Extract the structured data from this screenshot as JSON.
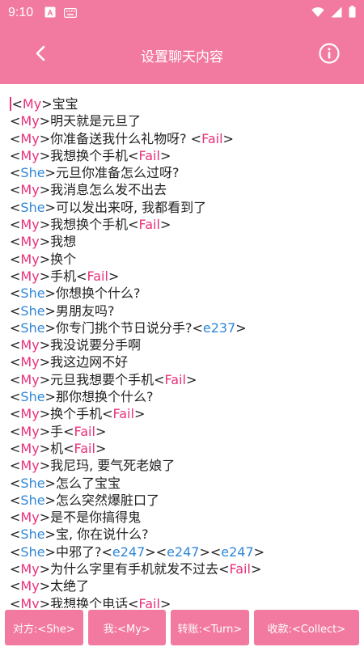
{
  "status_bar": {
    "time": "9:10",
    "icons": [
      "a-box-icon",
      "keyboard-icon",
      "wifi-icon",
      "cell-signal-icon",
      "battery-icon"
    ]
  },
  "app_bar": {
    "title": "设置聊天内容",
    "back_icon": "chevron-left-icon",
    "info_icon": "info-icon"
  },
  "colors": {
    "accent": "#f27aa0",
    "my_tag": "#e8317b",
    "she_tag": "#2f86d6",
    "fail_tag": "#e8317b",
    "emoji_tag": "#2f86d6"
  },
  "editor": {
    "lines": [
      [
        {
          "t": "<",
          "c": "p"
        },
        {
          "t": "My",
          "c": "my"
        },
        {
          "t": ">宝宝",
          "c": "p"
        }
      ],
      [
        {
          "t": "<",
          "c": "p"
        },
        {
          "t": "My",
          "c": "my"
        },
        {
          "t": ">明天就是元旦了",
          "c": "p"
        }
      ],
      [
        {
          "t": "<",
          "c": "p"
        },
        {
          "t": "My",
          "c": "my"
        },
        {
          "t": ">你准备送我什么礼物呀? <",
          "c": "p"
        },
        {
          "t": "Fail",
          "c": "fail"
        },
        {
          "t": ">",
          "c": "p"
        }
      ],
      [
        {
          "t": "<",
          "c": "p"
        },
        {
          "t": "My",
          "c": "my"
        },
        {
          "t": ">我想换个手机<",
          "c": "p"
        },
        {
          "t": "Fail",
          "c": "fail"
        },
        {
          "t": ">",
          "c": "p"
        }
      ],
      [
        {
          "t": "<",
          "c": "p"
        },
        {
          "t": "She",
          "c": "she"
        },
        {
          "t": ">元旦你准备怎么过呀?",
          "c": "p"
        }
      ],
      [
        {
          "t": "<",
          "c": "p"
        },
        {
          "t": "My",
          "c": "my"
        },
        {
          "t": ">我消息怎么发不出去",
          "c": "p"
        }
      ],
      [
        {
          "t": "<",
          "c": "p"
        },
        {
          "t": "She",
          "c": "she"
        },
        {
          "t": ">可以发出来呀, 我都看到了",
          "c": "p"
        }
      ],
      [
        {
          "t": "<",
          "c": "p"
        },
        {
          "t": "My",
          "c": "my"
        },
        {
          "t": ">我想换个手机<",
          "c": "p"
        },
        {
          "t": "Fail",
          "c": "fail"
        },
        {
          "t": ">",
          "c": "p"
        }
      ],
      [
        {
          "t": "<",
          "c": "p"
        },
        {
          "t": "My",
          "c": "my"
        },
        {
          "t": ">我想",
          "c": "p"
        }
      ],
      [
        {
          "t": "<",
          "c": "p"
        },
        {
          "t": "My",
          "c": "my"
        },
        {
          "t": ">换个",
          "c": "p"
        }
      ],
      [
        {
          "t": "<",
          "c": "p"
        },
        {
          "t": "My",
          "c": "my"
        },
        {
          "t": ">手机<",
          "c": "p"
        },
        {
          "t": "Fail",
          "c": "fail"
        },
        {
          "t": ">",
          "c": "p"
        }
      ],
      [
        {
          "t": "<",
          "c": "p"
        },
        {
          "t": "She",
          "c": "she"
        },
        {
          "t": ">你想换个什么?",
          "c": "p"
        }
      ],
      [
        {
          "t": "<",
          "c": "p"
        },
        {
          "t": "She",
          "c": "she"
        },
        {
          "t": ">男朋友吗?",
          "c": "p"
        }
      ],
      [
        {
          "t": "<",
          "c": "p"
        },
        {
          "t": "She",
          "c": "she"
        },
        {
          "t": ">你专门挑个节日说分手?<",
          "c": "p"
        },
        {
          "t": "e237",
          "c": "e"
        },
        {
          "t": ">",
          "c": "p"
        }
      ],
      [
        {
          "t": "<",
          "c": "p"
        },
        {
          "t": "My",
          "c": "my"
        },
        {
          "t": ">我没说要分手啊",
          "c": "p"
        }
      ],
      [
        {
          "t": "<",
          "c": "p"
        },
        {
          "t": "My",
          "c": "my"
        },
        {
          "t": ">我这边网不好",
          "c": "p"
        }
      ],
      [
        {
          "t": "<",
          "c": "p"
        },
        {
          "t": "My",
          "c": "my"
        },
        {
          "t": ">元旦我想要个手机<",
          "c": "p"
        },
        {
          "t": "Fail",
          "c": "fail"
        },
        {
          "t": ">",
          "c": "p"
        }
      ],
      [
        {
          "t": "<",
          "c": "p"
        },
        {
          "t": "She",
          "c": "she"
        },
        {
          "t": ">那你想换个什么?",
          "c": "p"
        }
      ],
      [
        {
          "t": "<",
          "c": "p"
        },
        {
          "t": "My",
          "c": "my"
        },
        {
          "t": ">换个手机<",
          "c": "p"
        },
        {
          "t": "Fail",
          "c": "fail"
        },
        {
          "t": ">",
          "c": "p"
        }
      ],
      [
        {
          "t": "<",
          "c": "p"
        },
        {
          "t": "My",
          "c": "my"
        },
        {
          "t": ">手<",
          "c": "p"
        },
        {
          "t": "Fail",
          "c": "fail"
        },
        {
          "t": ">",
          "c": "p"
        }
      ],
      [
        {
          "t": "<",
          "c": "p"
        },
        {
          "t": "My",
          "c": "my"
        },
        {
          "t": ">机<",
          "c": "p"
        },
        {
          "t": "Fail",
          "c": "fail"
        },
        {
          "t": ">",
          "c": "p"
        }
      ],
      [
        {
          "t": "<",
          "c": "p"
        },
        {
          "t": "My",
          "c": "my"
        },
        {
          "t": ">我尼玛, 要气死老娘了",
          "c": "p"
        }
      ],
      [
        {
          "t": "<",
          "c": "p"
        },
        {
          "t": "She",
          "c": "she"
        },
        {
          "t": ">怎么了宝宝",
          "c": "p"
        }
      ],
      [
        {
          "t": "<",
          "c": "p"
        },
        {
          "t": "She",
          "c": "she"
        },
        {
          "t": ">怎么突然爆脏口了",
          "c": "p"
        }
      ],
      [
        {
          "t": "<",
          "c": "p"
        },
        {
          "t": "My",
          "c": "my"
        },
        {
          "t": ">是不是你搞得鬼",
          "c": "p"
        }
      ],
      [
        {
          "t": "<",
          "c": "p"
        },
        {
          "t": "She",
          "c": "she"
        },
        {
          "t": ">宝, 你在说什么?",
          "c": "p"
        }
      ],
      [
        {
          "t": "<",
          "c": "p"
        },
        {
          "t": "She",
          "c": "she"
        },
        {
          "t": ">中邪了?<",
          "c": "p"
        },
        {
          "t": "e247",
          "c": "e"
        },
        {
          "t": "><",
          "c": "p"
        },
        {
          "t": "e247",
          "c": "e"
        },
        {
          "t": "><",
          "c": "p"
        },
        {
          "t": "e247",
          "c": "e"
        },
        {
          "t": ">",
          "c": "p"
        }
      ],
      [
        {
          "t": "<",
          "c": "p"
        },
        {
          "t": "My",
          "c": "my"
        },
        {
          "t": ">为什么字里有手机就发不过去<",
          "c": "p"
        },
        {
          "t": "Fail",
          "c": "fail"
        },
        {
          "t": ">",
          "c": "p"
        }
      ],
      [
        {
          "t": "<",
          "c": "p"
        },
        {
          "t": "My",
          "c": "my"
        },
        {
          "t": ">太绝了",
          "c": "p"
        }
      ],
      [
        {
          "t": "<",
          "c": "p"
        },
        {
          "t": "My",
          "c": "my"
        },
        {
          "t": ">我想换个电话<",
          "c": "p"
        },
        {
          "t": "Fail",
          "c": "fail"
        },
        {
          "t": ">",
          "c": "p"
        }
      ]
    ]
  },
  "bottom_buttons": [
    {
      "label": "对方:<She>",
      "name": "insert-she-button"
    },
    {
      "label": "我:<My>",
      "name": "insert-my-button"
    },
    {
      "label": "转账:<Turn>",
      "name": "insert-turn-button"
    },
    {
      "label": "收款:<Collect>",
      "name": "insert-collect-button"
    }
  ]
}
